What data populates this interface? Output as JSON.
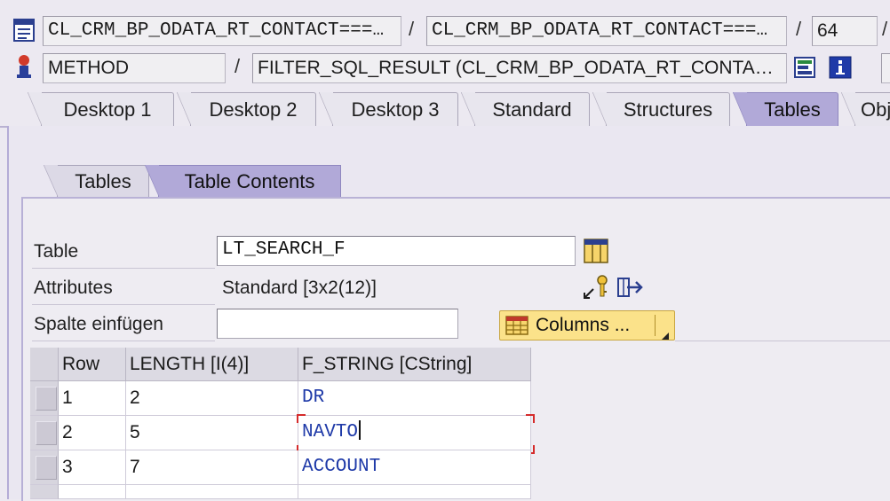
{
  "header": {
    "row1": {
      "field1": "CL_CRM_BP_ODATA_RT_CONTACT===…",
      "separator1": "/",
      "field2": "CL_CRM_BP_ODATA_RT_CONTACT===…",
      "separator2": "/",
      "line_number": "64",
      "separator3": "/"
    },
    "row2": {
      "type": "METHOD",
      "separator": "/",
      "method": "FILTER_SQL_RESULT (CL_CRM_BP_ODATA_RT_CONTA…"
    }
  },
  "tabs": [
    {
      "label": "Desktop 1"
    },
    {
      "label": "Desktop 2"
    },
    {
      "label": "Desktop 3"
    },
    {
      "label": "Standard"
    },
    {
      "label": "Structures"
    },
    {
      "label": "Tables"
    },
    {
      "label": "Obj"
    }
  ],
  "active_tab": "Tables",
  "subtabs": [
    {
      "label": "Tables"
    },
    {
      "label": "Table Contents"
    }
  ],
  "active_subtab": "Table Contents",
  "form": {
    "table_label": "Table",
    "table_value": "LT_SEARCH_F",
    "attributes_label": "Attributes",
    "attributes_value": "Standard [3x2(12)]",
    "insert_column_label": "Spalte einfügen",
    "insert_column_value": "",
    "columns_button": "Columns ..."
  },
  "grid": {
    "headers": [
      "Row",
      "LENGTH [I(4)]",
      "F_STRING [CString]"
    ],
    "rows": [
      {
        "row": "1",
        "length": "2",
        "f_string": "DR"
      },
      {
        "row": "2",
        "length": "5",
        "f_string": "NAVTO"
      },
      {
        "row": "3",
        "length": "7",
        "f_string": "ACCOUNT"
      }
    ]
  },
  "colors": {
    "active_tab": "#b1a9d8",
    "button_yellow": "#fbe28a",
    "value_blue": "#1f3aa8",
    "focus_red": "#d52b2b"
  },
  "icons": [
    "class-icon",
    "method-icon",
    "debugger-icon",
    "info-icon",
    "table-layout-icon",
    "key-icon",
    "export-icon",
    "grid-icon",
    "dropdown-arrow-icon"
  ]
}
